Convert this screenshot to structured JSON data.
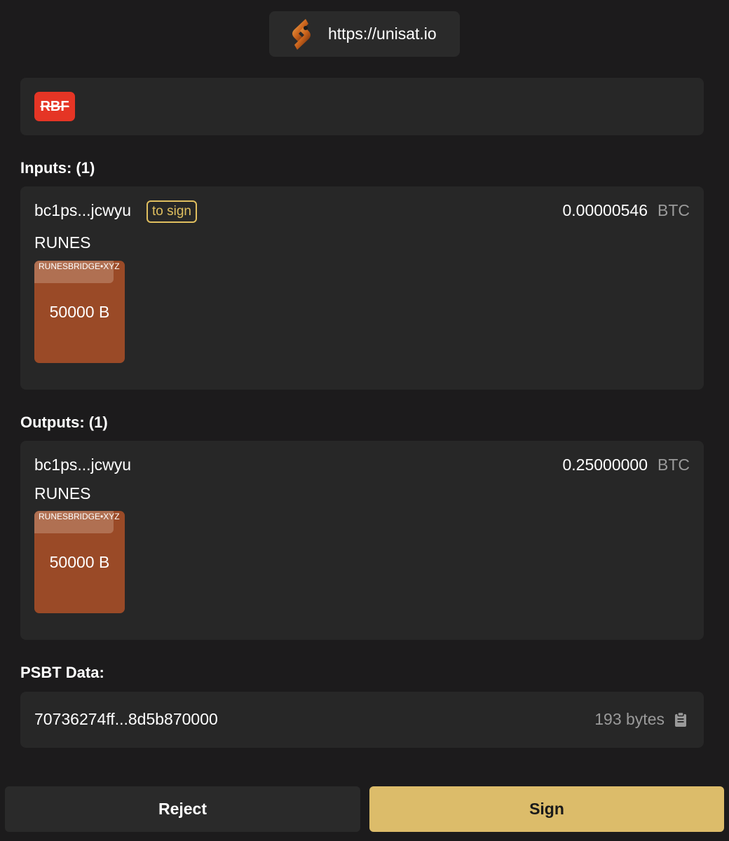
{
  "header": {
    "site_url": "https://unisat.io",
    "logo_icon": "unisat-logo-icon"
  },
  "flags": {
    "rbf_label": "RBF"
  },
  "inputs": {
    "heading": "Inputs: (1)",
    "items": [
      {
        "address": "bc1ps...jcwyu",
        "badge": "to sign",
        "amount": "0.00000546",
        "unit": "BTC",
        "asset_type": "RUNES",
        "rune": {
          "name": "RUNESBRIDGE•XYZ",
          "amount": "50000 B"
        }
      }
    ]
  },
  "outputs": {
    "heading": "Outputs: (1)",
    "items": [
      {
        "address": "bc1ps...jcwyu",
        "amount": "0.25000000",
        "unit": "BTC",
        "asset_type": "RUNES",
        "rune": {
          "name": "RUNESBRIDGE•XYZ",
          "amount": "50000 B"
        }
      }
    ]
  },
  "psbt": {
    "heading": "PSBT Data:",
    "hex": "70736274ff...8d5b870000",
    "size": "193 bytes",
    "copy_icon": "clipboard-icon"
  },
  "actions": {
    "reject_label": "Reject",
    "sign_label": "Sign"
  },
  "colors": {
    "background": "#1c1b1c",
    "card": "#272727",
    "accent_gold": "#dcbc6a",
    "rbf_red": "#e53525",
    "rune_tile": "#9a4a27"
  }
}
